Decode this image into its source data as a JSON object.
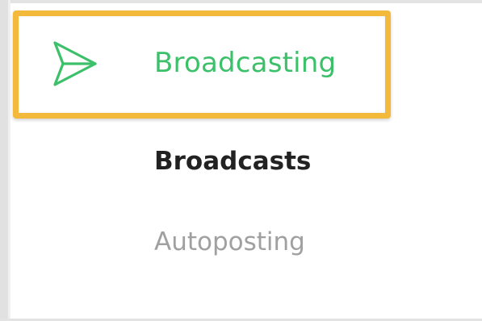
{
  "menu": {
    "active_item": {
      "label": "Broadcasting",
      "icon": "send-icon",
      "color": "#3cc06a",
      "highlight_color": "#f2b93b"
    },
    "sub_items": [
      {
        "label": "Broadcasts",
        "color": "#222222"
      },
      {
        "label": "Autoposting",
        "color": "#a0a0a0"
      }
    ]
  }
}
